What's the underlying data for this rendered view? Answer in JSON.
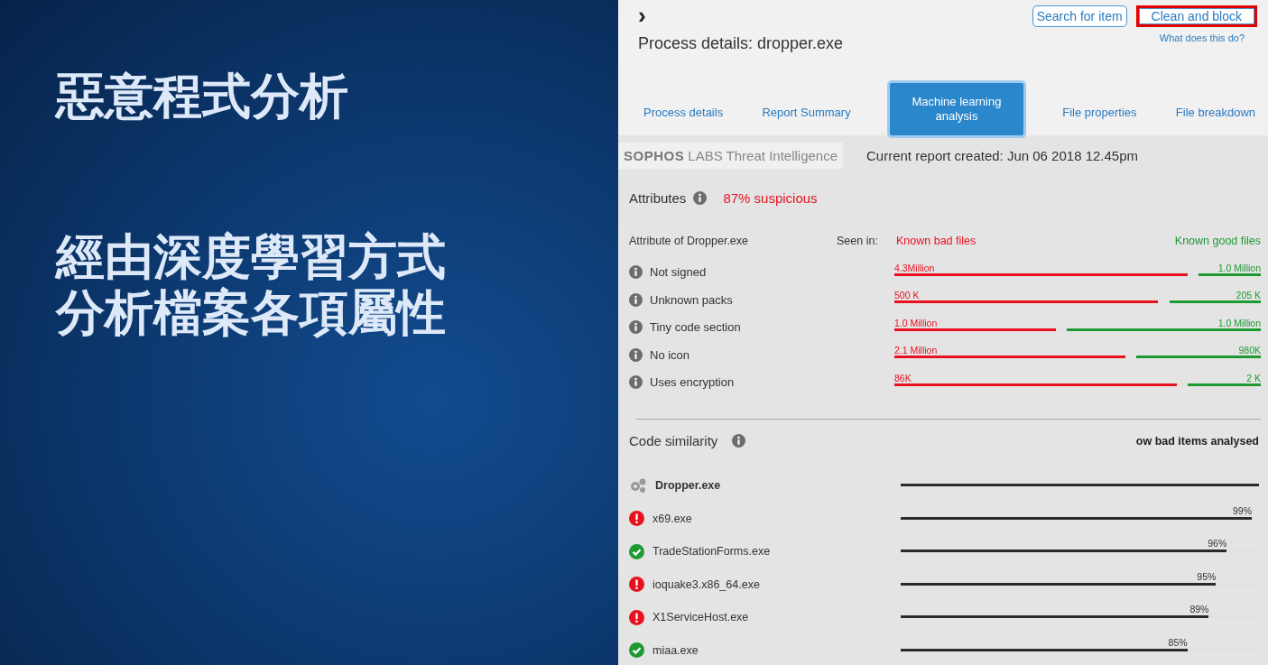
{
  "slide": {
    "title": "惡意程式分析",
    "subtitle_lines": [
      "經由深度學習方式",
      "分析檔案各項屬性"
    ]
  },
  "screenshot": {
    "expand_icon": "›",
    "title": "Process details: dropper.exe",
    "buttons": [
      {
        "label": "Search for item",
        "highlighted": false
      },
      {
        "label": "Clean and block",
        "highlighted": true
      }
    ],
    "help_link": "What does this do?",
    "tabs": [
      {
        "label": "Process details",
        "selected": false
      },
      {
        "label": "Report Summary",
        "selected": false
      },
      {
        "label": "Machine learning analysis",
        "selected": true
      },
      {
        "label": "File properties",
        "selected": false
      },
      {
        "label": "File breakdown",
        "selected": false
      }
    ],
    "brand": {
      "bold": "SOPHOS",
      "rest": "LABS Threat Intelligence"
    },
    "report_created": "Current report created: Jun 06 2018 12.45pm",
    "attributes": {
      "title": "Attributes",
      "verdict": "87% suspicious",
      "column_label": "Attribute of Dropper.exe",
      "seen_in": "Seen in:",
      "bad_label": "Known bad files",
      "good_label": "Known good files",
      "rows": [
        {
          "name": "Not signed",
          "bad": {
            "count": "4.3Million",
            "level": 0.8
          },
          "good": {
            "count": "1.0 Million",
            "level": 0.17
          }
        },
        {
          "name": "Unknown packs",
          "bad": {
            "count": "500 K",
            "level": 0.72
          },
          "good": {
            "count": "205 K",
            "level": 0.25
          }
        },
        {
          "name": "Tiny code section",
          "bad": {
            "count": "1.0 Million",
            "level": 0.44
          },
          "good": {
            "count": "1.0 Million",
            "level": 0.53
          }
        },
        {
          "name": "No icon",
          "bad": {
            "count": "2.1 Million",
            "level": 0.63
          },
          "good": {
            "count": "980K",
            "level": 0.34
          }
        },
        {
          "name": "Uses encryption",
          "bad": {
            "count": "86K",
            "level": 0.77
          },
          "good": {
            "count": "2 K",
            "level": 0.2
          }
        }
      ]
    },
    "code_similarity": {
      "title": "Code similarity",
      "right_heading": "ow bad items analysed",
      "rows": [
        {
          "name": "Dropper.exe",
          "kind": "source",
          "level": 1.0
        },
        {
          "name": "x69.exe",
          "kind": "bad",
          "percent": "99%",
          "level": 0.98
        },
        {
          "name": "TradeStationForms.exe",
          "kind": "good",
          "percent": "96%",
          "level": 0.91
        },
        {
          "name": "ioquake3.x86_64.exe",
          "kind": "bad",
          "percent": "95%",
          "level": 0.88
        },
        {
          "name": "X1ServiceHost.exe",
          "kind": "bad",
          "percent": "89%",
          "level": 0.86
        },
        {
          "name": "miaa.exe",
          "kind": "good",
          "percent": "85%",
          "level": 0.8
        }
      ]
    }
  }
}
